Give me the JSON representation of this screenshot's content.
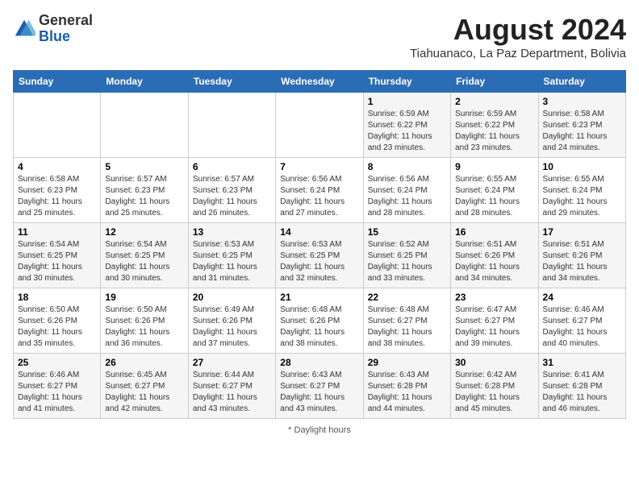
{
  "header": {
    "logo_general": "General",
    "logo_blue": "Blue",
    "month_year": "August 2024",
    "location": "Tiahuanaco, La Paz Department, Bolivia"
  },
  "weekdays": [
    "Sunday",
    "Monday",
    "Tuesday",
    "Wednesday",
    "Thursday",
    "Friday",
    "Saturday"
  ],
  "weeks": [
    [
      {
        "day": "",
        "info": ""
      },
      {
        "day": "",
        "info": ""
      },
      {
        "day": "",
        "info": ""
      },
      {
        "day": "",
        "info": ""
      },
      {
        "day": "1",
        "info": "Sunrise: 6:59 AM\nSunset: 6:22 PM\nDaylight: 11 hours and 23 minutes."
      },
      {
        "day": "2",
        "info": "Sunrise: 6:59 AM\nSunset: 6:22 PM\nDaylight: 11 hours and 23 minutes."
      },
      {
        "day": "3",
        "info": "Sunrise: 6:58 AM\nSunset: 6:23 PM\nDaylight: 11 hours and 24 minutes."
      }
    ],
    [
      {
        "day": "4",
        "info": "Sunrise: 6:58 AM\nSunset: 6:23 PM\nDaylight: 11 hours and 25 minutes."
      },
      {
        "day": "5",
        "info": "Sunrise: 6:57 AM\nSunset: 6:23 PM\nDaylight: 11 hours and 25 minutes."
      },
      {
        "day": "6",
        "info": "Sunrise: 6:57 AM\nSunset: 6:23 PM\nDaylight: 11 hours and 26 minutes."
      },
      {
        "day": "7",
        "info": "Sunrise: 6:56 AM\nSunset: 6:24 PM\nDaylight: 11 hours and 27 minutes."
      },
      {
        "day": "8",
        "info": "Sunrise: 6:56 AM\nSunset: 6:24 PM\nDaylight: 11 hours and 28 minutes."
      },
      {
        "day": "9",
        "info": "Sunrise: 6:55 AM\nSunset: 6:24 PM\nDaylight: 11 hours and 28 minutes."
      },
      {
        "day": "10",
        "info": "Sunrise: 6:55 AM\nSunset: 6:24 PM\nDaylight: 11 hours and 29 minutes."
      }
    ],
    [
      {
        "day": "11",
        "info": "Sunrise: 6:54 AM\nSunset: 6:25 PM\nDaylight: 11 hours and 30 minutes."
      },
      {
        "day": "12",
        "info": "Sunrise: 6:54 AM\nSunset: 6:25 PM\nDaylight: 11 hours and 30 minutes."
      },
      {
        "day": "13",
        "info": "Sunrise: 6:53 AM\nSunset: 6:25 PM\nDaylight: 11 hours and 31 minutes."
      },
      {
        "day": "14",
        "info": "Sunrise: 6:53 AM\nSunset: 6:25 PM\nDaylight: 11 hours and 32 minutes."
      },
      {
        "day": "15",
        "info": "Sunrise: 6:52 AM\nSunset: 6:25 PM\nDaylight: 11 hours and 33 minutes."
      },
      {
        "day": "16",
        "info": "Sunrise: 6:51 AM\nSunset: 6:26 PM\nDaylight: 11 hours and 34 minutes."
      },
      {
        "day": "17",
        "info": "Sunrise: 6:51 AM\nSunset: 6:26 PM\nDaylight: 11 hours and 34 minutes."
      }
    ],
    [
      {
        "day": "18",
        "info": "Sunrise: 6:50 AM\nSunset: 6:26 PM\nDaylight: 11 hours and 35 minutes."
      },
      {
        "day": "19",
        "info": "Sunrise: 6:50 AM\nSunset: 6:26 PM\nDaylight: 11 hours and 36 minutes."
      },
      {
        "day": "20",
        "info": "Sunrise: 6:49 AM\nSunset: 6:26 PM\nDaylight: 11 hours and 37 minutes."
      },
      {
        "day": "21",
        "info": "Sunrise: 6:48 AM\nSunset: 6:26 PM\nDaylight: 11 hours and 38 minutes."
      },
      {
        "day": "22",
        "info": "Sunrise: 6:48 AM\nSunset: 6:27 PM\nDaylight: 11 hours and 38 minutes."
      },
      {
        "day": "23",
        "info": "Sunrise: 6:47 AM\nSunset: 6:27 PM\nDaylight: 11 hours and 39 minutes."
      },
      {
        "day": "24",
        "info": "Sunrise: 6:46 AM\nSunset: 6:27 PM\nDaylight: 11 hours and 40 minutes."
      }
    ],
    [
      {
        "day": "25",
        "info": "Sunrise: 6:46 AM\nSunset: 6:27 PM\nDaylight: 11 hours and 41 minutes."
      },
      {
        "day": "26",
        "info": "Sunrise: 6:45 AM\nSunset: 6:27 PM\nDaylight: 11 hours and 42 minutes."
      },
      {
        "day": "27",
        "info": "Sunrise: 6:44 AM\nSunset: 6:27 PM\nDaylight: 11 hours and 43 minutes."
      },
      {
        "day": "28",
        "info": "Sunrise: 6:43 AM\nSunset: 6:27 PM\nDaylight: 11 hours and 43 minutes."
      },
      {
        "day": "29",
        "info": "Sunrise: 6:43 AM\nSunset: 6:28 PM\nDaylight: 11 hours and 44 minutes."
      },
      {
        "day": "30",
        "info": "Sunrise: 6:42 AM\nSunset: 6:28 PM\nDaylight: 11 hours and 45 minutes."
      },
      {
        "day": "31",
        "info": "Sunrise: 6:41 AM\nSunset: 6:28 PM\nDaylight: 11 hours and 46 minutes."
      }
    ]
  ],
  "footer": {
    "note": "Daylight hours"
  }
}
